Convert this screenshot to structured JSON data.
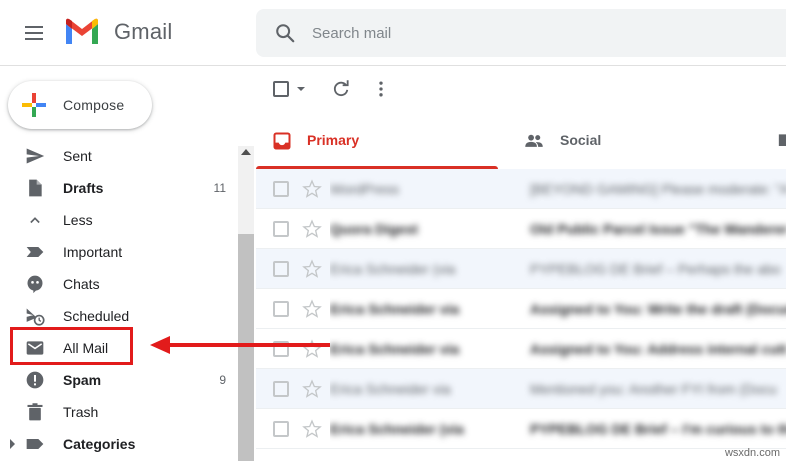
{
  "header": {
    "app_name": "Gmail",
    "search_placeholder": "Search mail"
  },
  "compose": {
    "label": "Compose"
  },
  "sidebar": {
    "items": [
      {
        "id": "sent",
        "label": "Sent",
        "count": "",
        "bold": false,
        "icon": "send-icon"
      },
      {
        "id": "drafts",
        "label": "Drafts",
        "count": "11",
        "bold": true,
        "icon": "draft-icon"
      },
      {
        "id": "less",
        "label": "Less",
        "count": "",
        "bold": false,
        "icon": "chevron-up-icon"
      },
      {
        "id": "important",
        "label": "Important",
        "count": "",
        "bold": false,
        "icon": "important-label-icon"
      },
      {
        "id": "chats",
        "label": "Chats",
        "count": "",
        "bold": false,
        "icon": "chat-bubble-icon"
      },
      {
        "id": "scheduled",
        "label": "Scheduled",
        "count": "",
        "bold": false,
        "icon": "scheduled-send-icon"
      },
      {
        "id": "all-mail",
        "label": "All Mail",
        "count": "",
        "bold": false,
        "icon": "mail-icon"
      },
      {
        "id": "spam",
        "label": "Spam",
        "count": "9",
        "bold": true,
        "icon": "spam-icon"
      },
      {
        "id": "trash",
        "label": "Trash",
        "count": "",
        "bold": false,
        "icon": "trash-icon"
      },
      {
        "id": "categories",
        "label": "Categories",
        "count": "",
        "bold": true,
        "icon": "label-icon"
      }
    ]
  },
  "tabs": [
    {
      "label": "Primary",
      "active": true
    },
    {
      "label": "Social",
      "active": false
    }
  ],
  "mail_rows": [
    {
      "sender": "WordPress",
      "subject": "[BEYOND GAMING] Please moderate: \"A",
      "unread": false
    },
    {
      "sender": "Quora Digest",
      "subject": "Old Public Parcel Issue \"The Wanderer",
      "unread": true
    },
    {
      "sender": "Erica Schneider (via",
      "subject": "PYPEBLOG DE Brief – Perhaps the abo",
      "unread": false
    },
    {
      "sender": "Erica Schneider via",
      "subject": "Assigned to You: Write the draft (Docume",
      "unread": true
    },
    {
      "sender": "Erica Schneider via",
      "subject": "Assigned to You: Address internal cutt",
      "unread": true
    },
    {
      "sender": "Erica Schneider via",
      "subject": "Mentioned you: Another FYI from (Docu",
      "unread": false
    },
    {
      "sender": "Erica Schneider (via",
      "subject": "PYPEBLOG DE Brief – I'm curious to the",
      "unread": true
    }
  ],
  "colors": {
    "accent_red": "#d93025",
    "annotation_red": "#e21b1b",
    "gmail_blue": "#4285f4",
    "gmail_green": "#34a853",
    "gmail_yellow": "#fbbc04"
  },
  "watermark": "wsxdn.com"
}
